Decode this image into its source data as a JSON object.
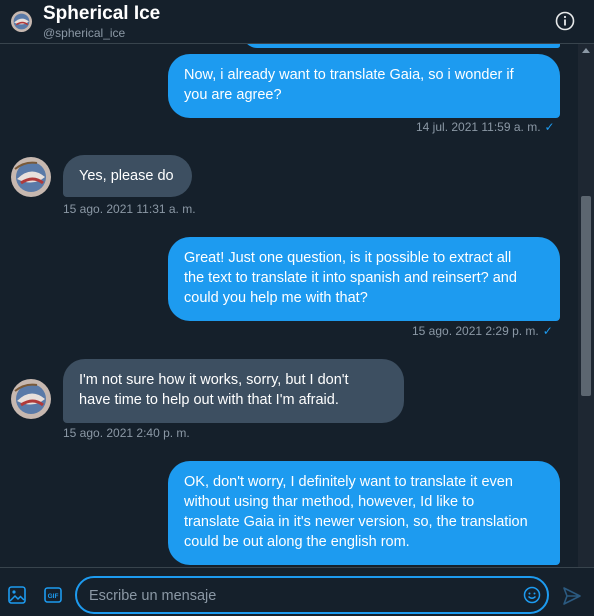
{
  "header": {
    "name": "Spherical Ice",
    "handle": "@spherical_ice"
  },
  "messages": [
    {
      "direction": "out",
      "text": "Now, i already want to translate Gaia, so i wonder if\nyou are agree?",
      "timestamp": "14 jul. 2021 11:59 a. m.",
      "status": "sent-check"
    },
    {
      "direction": "in",
      "text": "Yes, please do",
      "timestamp": "15 ago. 2021 11:31 a. m."
    },
    {
      "direction": "out",
      "text": "Great! Just one question, is it possible to extract all\nthe text to translate it into spanish and reinsert? and\ncould you help me with that?",
      "timestamp": "15 ago. 2021 2:29 p. m.",
      "status": "sent-check"
    },
    {
      "direction": "in",
      "text": "I'm not sure how it works, sorry, but I don't\nhave time to help out with that I'm afraid.",
      "timestamp": "15 ago. 2021 2:40 p. m."
    },
    {
      "direction": "out",
      "text": "OK, don't worry, I definitely want to translate it even\nwithout using thar method, however, Id like to\ntranslate Gaia in it's newer version, so, the translation\ncould be out along the english rom."
    }
  ],
  "composer": {
    "placeholder": "Escribe un mensaje",
    "icons": [
      "image-icon",
      "gif-icon",
      "emoji-icon",
      "send-icon"
    ]
  },
  "colors": {
    "background": "#15202b",
    "outgoing_bubble": "#1d9bf0",
    "incoming_bubble": "#3d4f61",
    "muted_text": "#8b98a5",
    "accent": "#1d9bf0"
  }
}
